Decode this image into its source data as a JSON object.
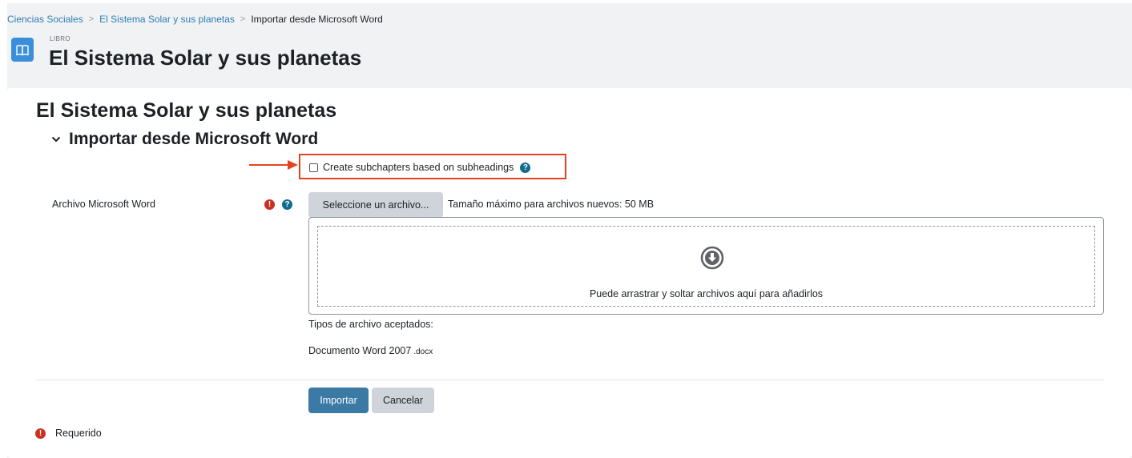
{
  "breadcrumb": {
    "items": [
      "Ciencias Sociales",
      "El Sistema Solar y sus planetas"
    ],
    "current": "Importar desde Microsoft Word",
    "separator": ">"
  },
  "header": {
    "module_type": "LIBRO",
    "title": "El Sistema Solar y sus planetas",
    "icon": "book-icon",
    "icon_color": "#3b8fd9"
  },
  "main": {
    "book_title": "El Sistema Solar y sus planetas",
    "section_title": "Importar desde Microsoft Word",
    "subchapters_checkbox": {
      "label": "Create subchapters based on subheadings",
      "checked": false
    },
    "file_field": {
      "label": "Archivo Microsoft Word",
      "choose_button": "Seleccione un archivo...",
      "max_size": "Tamaño máximo para archivos nuevos: 50 MB",
      "dropzone_text": "Puede arrastrar y soltar archivos aquí para añadirlos",
      "accepted_types_label": "Tipos de archivo aceptados:",
      "accepted_type_name": "Documento Word 2007",
      "accepted_type_ext": ".docx"
    },
    "buttons": {
      "import": "Importar",
      "cancel": "Cancelar"
    },
    "required_note": "Requerido"
  },
  "colors": {
    "link": "#2e7eb5",
    "primary_button": "#3a7aa5",
    "secondary_button": "#ced4da",
    "required": "#ca3120",
    "help": "#0f6cbf",
    "highlight": "#e3431f"
  }
}
